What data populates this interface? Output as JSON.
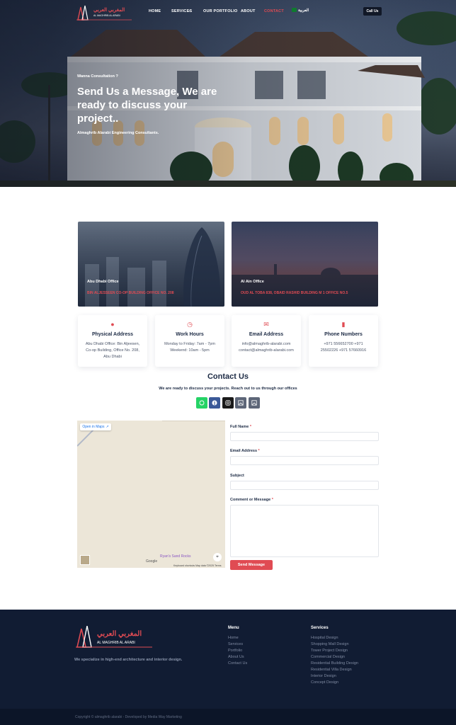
{
  "nav": {
    "items": [
      {
        "label": "HOME",
        "active": false
      },
      {
        "label": "SERVICES",
        "active": false,
        "has_dropdown": true
      },
      {
        "label": "OUR PORTFOLIO",
        "active": false
      },
      {
        "label": "ABOUT",
        "active": false
      },
      {
        "label": "CONTACT",
        "active": true
      }
    ],
    "language_label": "العربية",
    "call_button": "Call Us"
  },
  "logo": {
    "arabic_text": "المغربي العربي",
    "english_text": "AL MAGHRIB AL ARABI"
  },
  "hero": {
    "eyebrow": "Wanna Consultation ?",
    "title": "Send Us a Message, We are ready to discuss your project..",
    "subtitle": "Almaghrib Alarabi Engineering Consultants."
  },
  "offices": [
    {
      "name": "Abu Dhabi Office",
      "address": "BIN ALJESSEEN CO-OP BUILDING OFFICE NO. 208"
    },
    {
      "name": "Al Ain Office",
      "address": "OUD AL TOBA 838, OBAID RASHID BUILDING M 1 OFFICE NO.5"
    }
  ],
  "info_cards": [
    {
      "icon": "map-marker-icon",
      "title": "Physical Address",
      "text": "Abu Dhabi Office: Bin Aljeesen, Co-op Building, Office No. 208, Abu Dhabi"
    },
    {
      "icon": "clock-icon",
      "title": "Work Hours",
      "text": "Monday to Friday: 7am - 7pm Weekend: 10am - 5pm"
    },
    {
      "icon": "envelope-icon",
      "title": "Email Address",
      "text": "info@almaghrib-alarabi.com contact@almaghrib-alarabi.com"
    },
    {
      "icon": "phone-icon",
      "title": "Phone Numbers",
      "text": "+971 556652700 +971 25502226 +971 57660916"
    }
  ],
  "contact": {
    "title": "Contact Us",
    "subtitle": "We are ready to discuss your projects. Reach out to us through our offices"
  },
  "social": [
    {
      "icon": "whatsapp-icon",
      "color": "#25d366"
    },
    {
      "icon": "facebook-icon",
      "color": "#3b5998"
    },
    {
      "icon": "instagram-icon",
      "color": "#1a1a1a"
    },
    {
      "icon": "image-icon",
      "color": "#5d6678"
    },
    {
      "icon": "image-icon",
      "color": "#5d6678"
    }
  ],
  "map": {
    "open_label": "Open in Maps",
    "place_label": "Ryan's Sand Rocks",
    "google_label": "Google",
    "footer_text": "Keyboard shortcuts   Map data ©2025   Terms"
  },
  "form": {
    "full_name_label": "Full Name",
    "email_label": "Email Address",
    "subject_label": "Subject",
    "comment_label": "Comment or Message",
    "required_mark": "*",
    "submit_label": "Send Message"
  },
  "footer": {
    "tagline": "We specialize in high-end architecture and interior design.",
    "menu_heading": "Menu",
    "menu_links": [
      "Home",
      "Services",
      "Portfolio",
      "About Us",
      "Contact Us"
    ],
    "services_heading": "Services",
    "services_links": [
      "Hospital Design",
      "Shopping Mall Design",
      "Tower Project Design",
      "Commercial Design",
      "Residential Building Design",
      "Residential Villa Design",
      "Interior Design",
      "Concept Design"
    ],
    "copyright": "Copyright © almaghrib alarabi - Developed by Media Way Marketing"
  },
  "colors": {
    "accent": "#e04b53",
    "navy": "#111c33",
    "text": "#1c2a44"
  }
}
